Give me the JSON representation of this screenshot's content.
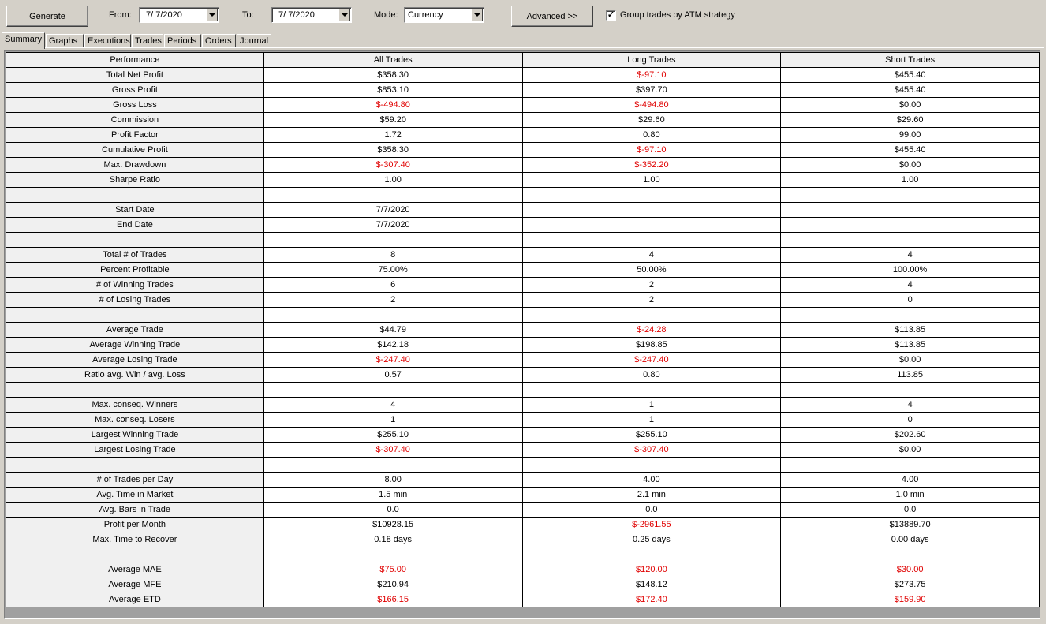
{
  "toolbar": {
    "generate_label": "Generate",
    "from_label": "From:",
    "from_value": "7/ 7/2020",
    "to_label": "To:",
    "to_value": "7/ 7/2020",
    "mode_label": "Mode:",
    "mode_value": "Currency",
    "advanced_label": "Advanced >>",
    "group_checked": true,
    "group_label": "Group trades by ATM strategy"
  },
  "tabs": [
    "Summary",
    "Graphs",
    "Executions",
    "Trades",
    "Periods",
    "Orders",
    "Journal"
  ],
  "active_tab": "Summary",
  "columns": [
    "Performance",
    "All Trades",
    "Long Trades",
    "Short Trades"
  ],
  "rows": [
    {
      "label": "Total Net Profit",
      "values": [
        "$358.30",
        "$-97.10",
        "$455.40"
      ],
      "neg": [
        false,
        true,
        false
      ]
    },
    {
      "label": "Gross Profit",
      "values": [
        "$853.10",
        "$397.70",
        "$455.40"
      ],
      "neg": [
        false,
        false,
        false
      ]
    },
    {
      "label": "Gross Loss",
      "values": [
        "$-494.80",
        "$-494.80",
        "$0.00"
      ],
      "neg": [
        true,
        true,
        false
      ]
    },
    {
      "label": "Commission",
      "values": [
        "$59.20",
        "$29.60",
        "$29.60"
      ],
      "neg": [
        false,
        false,
        false
      ]
    },
    {
      "label": "Profit Factor",
      "values": [
        "1.72",
        "0.80",
        "99.00"
      ],
      "neg": [
        false,
        false,
        false
      ]
    },
    {
      "label": "Cumulative Profit",
      "values": [
        "$358.30",
        "$-97.10",
        "$455.40"
      ],
      "neg": [
        false,
        true,
        false
      ]
    },
    {
      "label": "Max. Drawdown",
      "values": [
        "$-307.40",
        "$-352.20",
        "$0.00"
      ],
      "neg": [
        true,
        true,
        false
      ]
    },
    {
      "label": "Sharpe Ratio",
      "values": [
        "1.00",
        "1.00",
        "1.00"
      ],
      "neg": [
        false,
        false,
        false
      ]
    },
    {
      "label": "",
      "values": [
        "",
        "",
        ""
      ],
      "neg": [
        false,
        false,
        false
      ]
    },
    {
      "label": "Start Date",
      "values": [
        "7/7/2020",
        "",
        ""
      ],
      "neg": [
        false,
        false,
        false
      ]
    },
    {
      "label": "End Date",
      "values": [
        "7/7/2020",
        "",
        ""
      ],
      "neg": [
        false,
        false,
        false
      ]
    },
    {
      "label": "",
      "values": [
        "",
        "",
        ""
      ],
      "neg": [
        false,
        false,
        false
      ]
    },
    {
      "label": "Total # of Trades",
      "values": [
        "8",
        "4",
        "4"
      ],
      "neg": [
        false,
        false,
        false
      ]
    },
    {
      "label": "Percent Profitable",
      "values": [
        "75.00%",
        "50.00%",
        "100.00%"
      ],
      "neg": [
        false,
        false,
        false
      ]
    },
    {
      "label": "# of Winning Trades",
      "values": [
        "6",
        "2",
        "4"
      ],
      "neg": [
        false,
        false,
        false
      ]
    },
    {
      "label": "# of Losing Trades",
      "values": [
        "2",
        "2",
        "0"
      ],
      "neg": [
        false,
        false,
        false
      ]
    },
    {
      "label": "",
      "values": [
        "",
        "",
        ""
      ],
      "neg": [
        false,
        false,
        false
      ]
    },
    {
      "label": "Average Trade",
      "values": [
        "$44.79",
        "$-24.28",
        "$113.85"
      ],
      "neg": [
        false,
        true,
        false
      ]
    },
    {
      "label": "Average Winning Trade",
      "values": [
        "$142.18",
        "$198.85",
        "$113.85"
      ],
      "neg": [
        false,
        false,
        false
      ]
    },
    {
      "label": "Average Losing Trade",
      "values": [
        "$-247.40",
        "$-247.40",
        "$0.00"
      ],
      "neg": [
        true,
        true,
        false
      ]
    },
    {
      "label": "Ratio avg. Win / avg. Loss",
      "values": [
        "0.57",
        "0.80",
        "113.85"
      ],
      "neg": [
        false,
        false,
        false
      ]
    },
    {
      "label": "",
      "values": [
        "",
        "",
        ""
      ],
      "neg": [
        false,
        false,
        false
      ]
    },
    {
      "label": "Max. conseq. Winners",
      "values": [
        "4",
        "1",
        "4"
      ],
      "neg": [
        false,
        false,
        false
      ]
    },
    {
      "label": "Max. conseq. Losers",
      "values": [
        "1",
        "1",
        "0"
      ],
      "neg": [
        false,
        false,
        false
      ]
    },
    {
      "label": "Largest Winning Trade",
      "values": [
        "$255.10",
        "$255.10",
        "$202.60"
      ],
      "neg": [
        false,
        false,
        false
      ]
    },
    {
      "label": "Largest Losing Trade",
      "values": [
        "$-307.40",
        "$-307.40",
        "$0.00"
      ],
      "neg": [
        true,
        true,
        false
      ]
    },
    {
      "label": "",
      "values": [
        "",
        "",
        ""
      ],
      "neg": [
        false,
        false,
        false
      ]
    },
    {
      "label": "# of Trades per Day",
      "values": [
        "8.00",
        "4.00",
        "4.00"
      ],
      "neg": [
        false,
        false,
        false
      ]
    },
    {
      "label": "Avg. Time in Market",
      "values": [
        "1.5 min",
        "2.1 min",
        "1.0 min"
      ],
      "neg": [
        false,
        false,
        false
      ]
    },
    {
      "label": "Avg. Bars in Trade",
      "values": [
        "0.0",
        "0.0",
        "0.0"
      ],
      "neg": [
        false,
        false,
        false
      ]
    },
    {
      "label": "Profit per Month",
      "values": [
        "$10928.15",
        "$-2961.55",
        "$13889.70"
      ],
      "neg": [
        false,
        true,
        false
      ]
    },
    {
      "label": "Max. Time to Recover",
      "values": [
        "0.18 days",
        "0.25 days",
        "0.00 days"
      ],
      "neg": [
        false,
        false,
        false
      ]
    },
    {
      "label": "",
      "values": [
        "",
        "",
        ""
      ],
      "neg": [
        false,
        false,
        false
      ]
    },
    {
      "label": "Average MAE",
      "values": [
        "$75.00",
        "$120.00",
        "$30.00"
      ],
      "neg": [
        true,
        true,
        true
      ]
    },
    {
      "label": "Average MFE",
      "values": [
        "$210.94",
        "$148.12",
        "$273.75"
      ],
      "neg": [
        false,
        false,
        false
      ]
    },
    {
      "label": "Average ETD",
      "values": [
        "$166.15",
        "$172.40",
        "$159.90"
      ],
      "neg": [
        true,
        true,
        true
      ]
    }
  ]
}
